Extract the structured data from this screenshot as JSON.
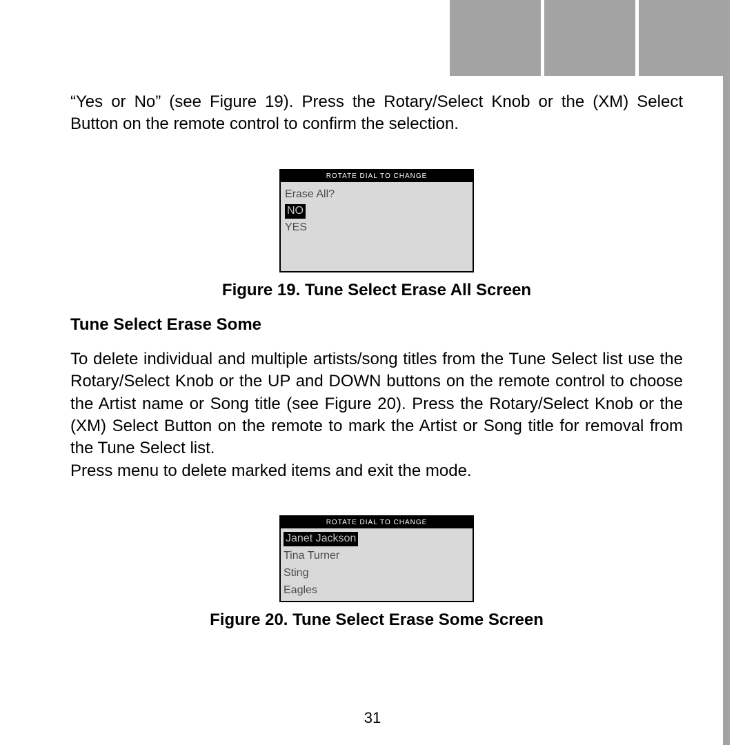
{
  "topTabs": [
    "",
    "",
    ""
  ],
  "para1": "“Yes or No” (see Figure 19).  Press the Rotary/Select Knob or the (XM) Select Button on the remote control to confirm the selection.",
  "lcd1": {
    "header": "ROTATE DIAL TO CHANGE",
    "prompt": "Erase All?",
    "options": [
      {
        "label": "NO",
        "selected": true
      },
      {
        "label": "YES",
        "selected": false
      }
    ],
    "caption": "Figure 19. Tune Select Erase All Screen"
  },
  "heading2": "Tune Select Erase Some",
  "para2": "To delete individual and multiple artists/song titles from the Tune Select list use the Rotary/Select Knob or the UP and DOWN buttons on the remote control to choose the Artist name or Song title (see Figure 20). Press the Rotary/Select Knob or the (XM) Select Button on the remote to mark the Artist or Song title for removal from the Tune Select list.",
  "para2b": "Press menu to delete marked items and exit the mode.",
  "lcd2": {
    "header": "ROTATE DIAL TO CHANGE",
    "items": [
      {
        "label": "Janet Jackson",
        "selected": true
      },
      {
        "label": "Tina Turner",
        "selected": false
      },
      {
        "label": "Sting",
        "selected": false
      },
      {
        "label": "Eagles",
        "selected": false
      }
    ],
    "caption": "Figure 20. Tune Select Erase Some Screen"
  },
  "pageNumber": "31"
}
